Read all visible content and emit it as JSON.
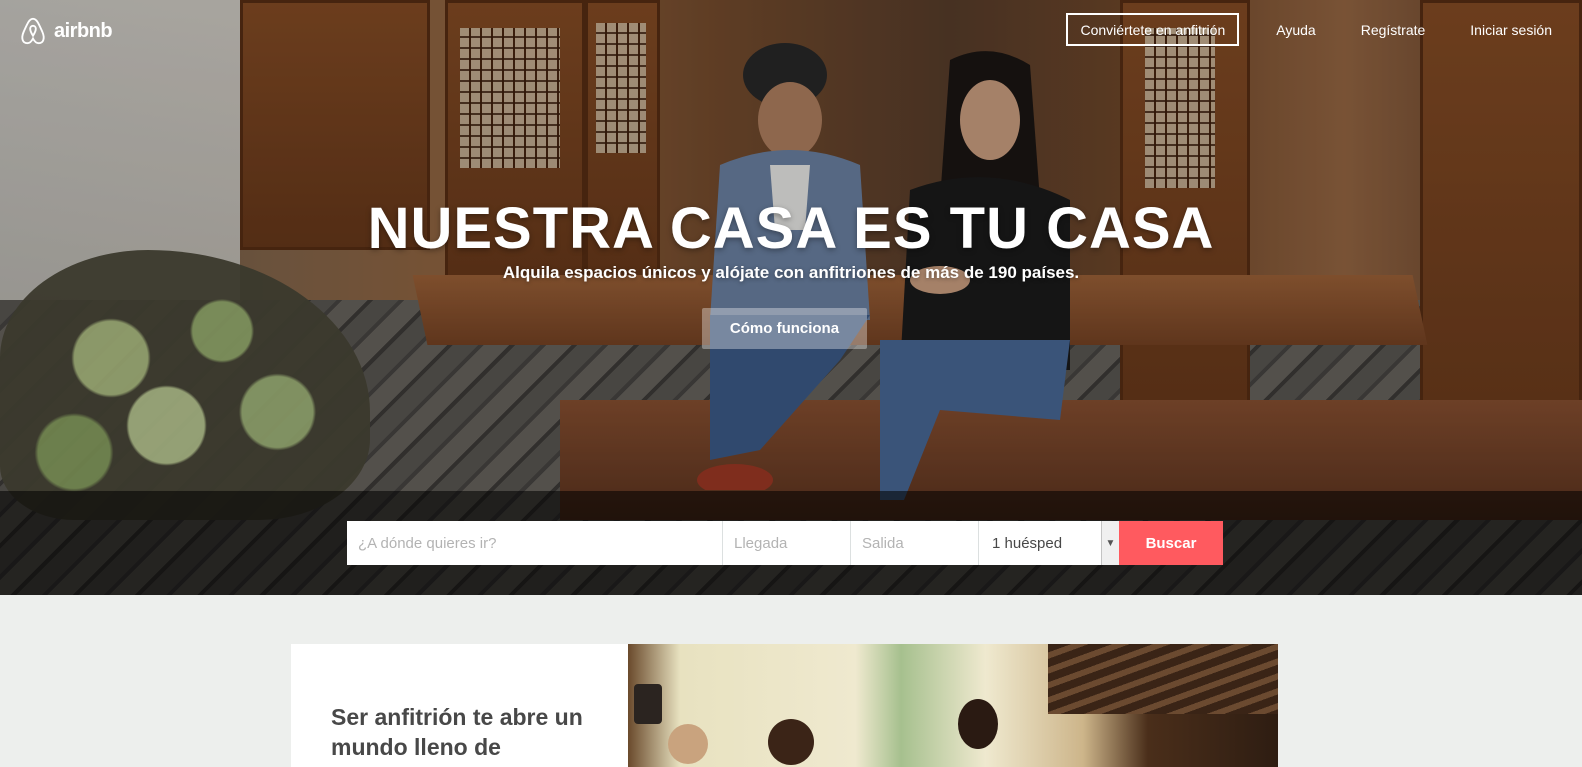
{
  "brand": {
    "name": "airbnb",
    "accent": "#ff5a5f"
  },
  "nav": {
    "host_label": "Conviértete en anfitrión",
    "help_label": "Ayuda",
    "signup_label": "Regístrate",
    "login_label": "Iniciar sesión"
  },
  "hero": {
    "title": "NUESTRA CASA ES TU CASA",
    "subtitle": "Alquila espacios únicos y alójate con anfitriones de más de 190 países.",
    "how_label": "Cómo funciona"
  },
  "search": {
    "where_placeholder": "¿A dónde quieres ir?",
    "checkin_placeholder": "Llegada",
    "checkout_placeholder": "Salida",
    "guests_value": "1 huésped",
    "submit_label": "Buscar"
  },
  "promo": {
    "title": "Ser anfitrión te abre un mundo lleno de"
  }
}
